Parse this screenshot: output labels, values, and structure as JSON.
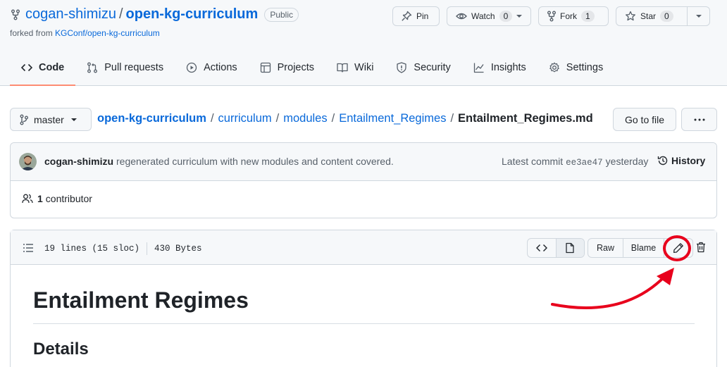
{
  "repo": {
    "owner": "cogan-shimizu",
    "separator": "/",
    "name": "open-kg-curriculum",
    "visibility": "Public",
    "forked_prefix": "forked from",
    "forked_source": "KGConf/open-kg-curriculum"
  },
  "actions": {
    "pin": "Pin",
    "watch": "Watch",
    "watch_count": "0",
    "fork": "Fork",
    "fork_count": "1",
    "star": "Star",
    "star_count": "0"
  },
  "tabs": [
    {
      "label": "Code",
      "icon": "code-icon",
      "active": true
    },
    {
      "label": "Pull requests",
      "icon": "pull-request-icon"
    },
    {
      "label": "Actions",
      "icon": "play-icon"
    },
    {
      "label": "Projects",
      "icon": "table-icon"
    },
    {
      "label": "Wiki",
      "icon": "book-icon"
    },
    {
      "label": "Security",
      "icon": "shield-icon"
    },
    {
      "label": "Insights",
      "icon": "graph-icon"
    },
    {
      "label": "Settings",
      "icon": "gear-icon"
    }
  ],
  "file_nav": {
    "branch": "master",
    "breadcrumb": [
      "open-kg-curriculum",
      "curriculum",
      "modules",
      "Entailment_Regimes"
    ],
    "separator": "/",
    "current_file": "Entailment_Regimes.md",
    "go_to_file": "Go to file"
  },
  "commit": {
    "author": "cogan-shimizu",
    "message": "regenerated curriculum with new modules and content covered.",
    "latest_label": "Latest commit",
    "hash": "ee3ae47",
    "time": "yesterday",
    "history": "History",
    "contributor_count": "1",
    "contributor_label": "contributor"
  },
  "file": {
    "lines": "19 lines (15 sloc)",
    "size": "430 Bytes",
    "raw": "Raw",
    "blame": "Blame"
  },
  "content": {
    "h1": "Entailment Regimes",
    "h2": "Details"
  },
  "colors": {
    "link": "#0969da",
    "active_tab_underline": "#fd8c73",
    "annotation": "#e8001c"
  }
}
